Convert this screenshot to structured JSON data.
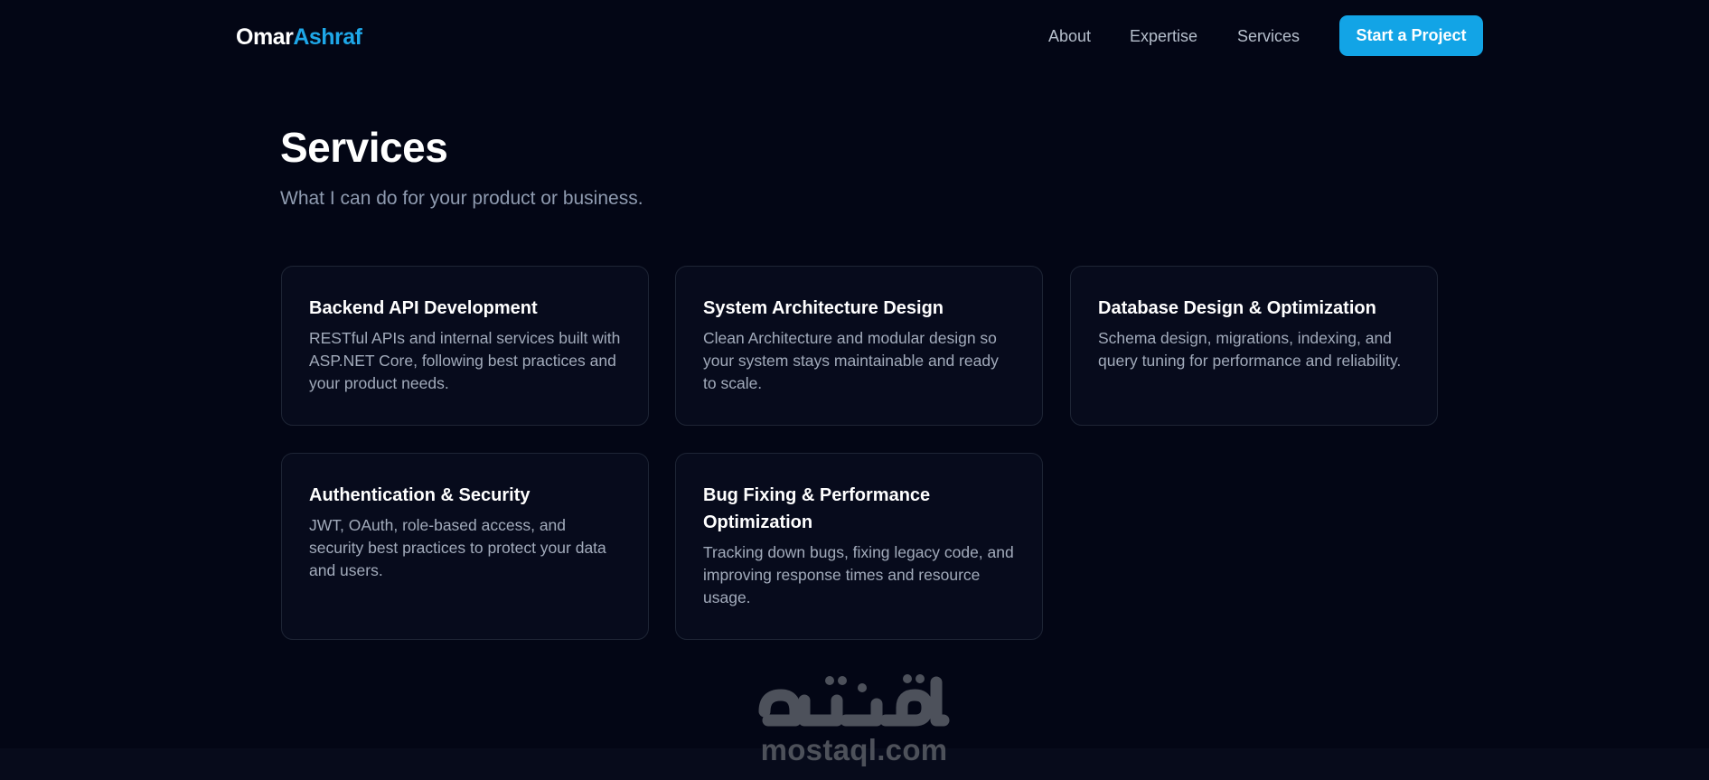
{
  "header": {
    "logo_first": "Omar",
    "logo_last": "Ashraf",
    "nav": [
      "About",
      "Expertise",
      "Services"
    ],
    "cta_label": "Start a Project"
  },
  "section": {
    "title": "Services",
    "subtitle": "What I can do for your product or business."
  },
  "cards": [
    {
      "title": "Backend API Development",
      "description": "RESTful APIs and internal services built with ASP.NET Core, following best practices and your product needs."
    },
    {
      "title": "System Architecture Design",
      "description": "Clean Architecture and modular design so your system stays maintainable and ready to scale."
    },
    {
      "title": "Database Design & Optimization",
      "description": "Schema design, migrations, indexing, and query tuning for performance and reliability."
    },
    {
      "title": "Authentication & Security",
      "description": "JWT, OAuth, role-based access, and security best practices to protect your data and users."
    },
    {
      "title": "Bug Fixing & Performance Optimization",
      "description": "Tracking down bugs, fixing legacy code, and improving response times and resource usage."
    }
  ],
  "watermark": {
    "text": "mostaql.com"
  },
  "colors": {
    "background": "#030615",
    "accent": "#12a4e6",
    "card_bg": "#070b1c",
    "card_border": "#1e2535"
  }
}
